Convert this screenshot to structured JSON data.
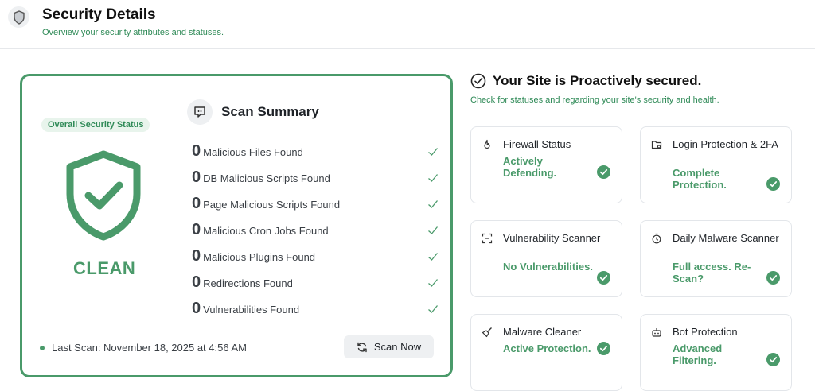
{
  "header": {
    "title": "Security Details",
    "subtitle": "Overview your security attributes and statuses."
  },
  "overall": {
    "badge": "Overall Security Status",
    "status": "CLEAN"
  },
  "summary": {
    "title": "Scan Summary",
    "items": [
      {
        "count": "0",
        "label": "Malicious Files Found"
      },
      {
        "count": "0",
        "label": "DB Malicious Scripts Found"
      },
      {
        "count": "0",
        "label": "Page Malicious Scripts Found"
      },
      {
        "count": "0",
        "label": "Malicious Cron Jobs Found"
      },
      {
        "count": "0",
        "label": "Malicious Plugins Found"
      },
      {
        "count": "0",
        "label": "Redirections Found"
      },
      {
        "count": "0",
        "label": "Vulnerabilities Found"
      }
    ],
    "last_scan": "Last Scan: November 18, 2025 at 4:56 AM",
    "scan_button": "Scan Now"
  },
  "right": {
    "title": "Your Site is Proactively secured.",
    "subtitle": "Check for statuses and regarding your site's security and health.",
    "features": [
      {
        "icon": "flame-icon",
        "title": "Firewall Status",
        "status": "Actively Defending."
      },
      {
        "icon": "login-folder-icon",
        "title": "Login Protection & 2FA",
        "status": "Complete Protection."
      },
      {
        "icon": "scan-frame-icon",
        "title": "Vulnerability Scanner",
        "status": "No Vulnerabilities."
      },
      {
        "icon": "timer-icon",
        "title": "Daily Malware Scanner",
        "status": "Full access. Re-Scan?"
      },
      {
        "icon": "broom-icon",
        "title": "Malware Cleaner",
        "status": "Active Protection."
      },
      {
        "icon": "bot-icon",
        "title": "Bot Protection",
        "status": "Advanced Filtering."
      }
    ]
  },
  "colors": {
    "accent": "#4a9a6a",
    "accent_text": "#2f8a57",
    "badge_bg": "#e8f4ec"
  }
}
